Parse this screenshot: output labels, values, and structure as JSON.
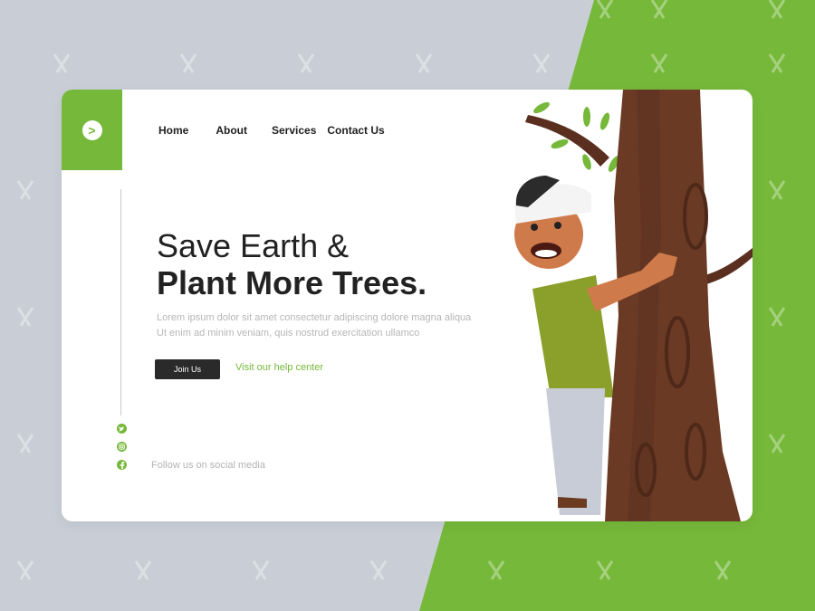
{
  "colors": {
    "accent": "#76b83a",
    "dark": "#2a2a2a",
    "background": "#c9ced6",
    "card": "#ffffff"
  },
  "logo": {
    "icon": "chevron-right-icon",
    "glyph": ">"
  },
  "nav": {
    "items": [
      "Home",
      "About",
      "Services",
      "Contact Us"
    ]
  },
  "hero": {
    "title_line1": "Save Earth &",
    "title_line2": "Plant More Trees.",
    "body_line1": "Lorem ipsum dolor sit amet consectetur adipiscing dolore magna aliqua",
    "body_line2": "Ut enim ad minim veniam, quis nostrud exercitation ullamco",
    "cta_label": "Join Us",
    "help_link": "Visit our help center"
  },
  "social": {
    "icons": [
      "twitter-icon",
      "instagram-icon",
      "facebook-icon"
    ],
    "follow_text": "Follow us on social media"
  }
}
